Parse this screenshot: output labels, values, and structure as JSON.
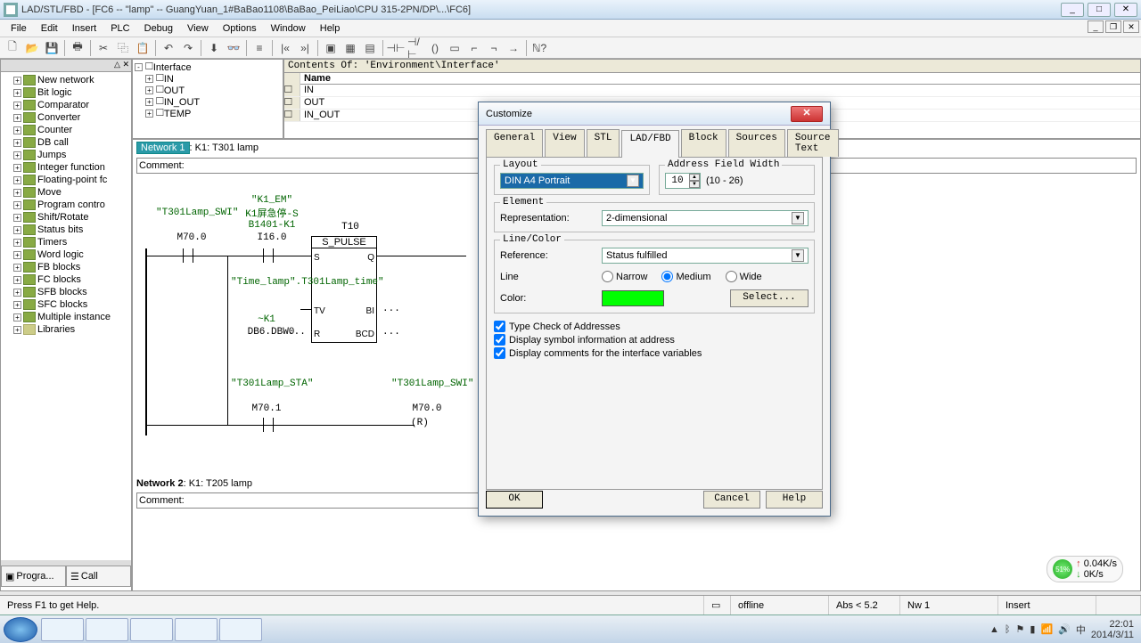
{
  "window": {
    "title": "LAD/STL/FBD  - [FC6 -- \"lamp\" -- GuangYuan_1#BaBao1108\\BaBao_PeiLiao\\CPU 315-2PN/DP\\...\\FC6]"
  },
  "menu": [
    "File",
    "Edit",
    "Insert",
    "PLC",
    "Debug",
    "View",
    "Options",
    "Window",
    "Help"
  ],
  "left_tree": [
    "New network",
    "Bit logic",
    "Comparator",
    "Converter",
    "Counter",
    "DB call",
    "Jumps",
    "Integer function",
    "Floating-point fc",
    "Move",
    "Program contro",
    "Shift/Rotate",
    "Status bits",
    "Timers",
    "Word logic",
    "FB blocks",
    "FC blocks",
    "SFB blocks",
    "SFC blocks",
    "Multiple instance",
    "Libraries"
  ],
  "bottom_tabs": {
    "left": "Progra...",
    "right": "Call"
  },
  "iface": {
    "header": "Contents Of: 'Environment\\Interface'",
    "root": "Interface",
    "nodes": [
      "IN",
      "OUT",
      "IN_OUT",
      "TEMP"
    ],
    "grid_header": "Name",
    "grid_rows": [
      "IN",
      "OUT",
      "IN_OUT"
    ]
  },
  "editor": {
    "net1": {
      "badge": "Network 1",
      "title": ": K1: T301 lamp",
      "comment": "Comment:"
    },
    "net2": {
      "badge_plain": "Network 2",
      "title": ": K1: T205 lamp",
      "comment": "Comment:"
    },
    "labels": {
      "swi": "\"T301Lamp_SWI\"",
      "swi_addr": "M70.0",
      "k1em": "\"K1_EM\"",
      "k1em_desc": "K1屏急停-S B1401-K1",
      "k1em_addr": "I16.0",
      "t10": "T10",
      "spulse": "S_PULSE",
      "s": "S",
      "q": "Q",
      "timelamp": "\"Time_lamp\".T301Lamp_time\"",
      "timelamp_k1": "~K1",
      "timelamp_addr": "DB6.DBW0",
      "tv": "TV",
      "bi": "BI",
      "r": "R",
      "bcd": "BCD",
      "dots": "...",
      "sta": "\"T301Lamp_STA\"",
      "sta_addr": "M70.1",
      "swi2": "\"T301Lamp_SWI\"",
      "swi2_addr": "M70.0",
      "coil_r": "(R)"
    }
  },
  "dialog": {
    "title": "Customize",
    "tabs": [
      "General",
      "View",
      "STL",
      "LAD/FBD",
      "Block",
      "Sources",
      "Source Text"
    ],
    "active_tab": 3,
    "layout": {
      "legend": "Layout",
      "value": "DIN A4 Portrait"
    },
    "addr": {
      "legend": "Address Field Width",
      "value": "10",
      "range": "(10 - 26)"
    },
    "element": {
      "legend": "Element",
      "rep_label": "Representation:",
      "rep_value": "2-dimensional"
    },
    "linecolor": {
      "legend": "Line/Color",
      "ref_label": "Reference:",
      "ref_value": "Status fulfilled",
      "line_label": "Line",
      "radios": [
        "Narrow",
        "Medium",
        "Wide"
      ],
      "color_label": "Color:",
      "select_btn": "Select...",
      "color_hex": "#00ff00"
    },
    "checks": [
      "Type Check of Addresses",
      "Display symbol information at address",
      "Display comments for the interface variables"
    ],
    "buttons": {
      "ok": "OK",
      "cancel": "Cancel",
      "help": "Help"
    }
  },
  "status": {
    "hint": "Press F1 to get Help.",
    "offline": "offline",
    "abs": "Abs < 5.2",
    "nw": "Nw 1",
    "insert": "Insert"
  },
  "speed": {
    "pct": "51%",
    "up": "0.04K/s",
    "down": "0K/s"
  },
  "tray": {
    "time": "22:01",
    "date": "2014/3/11"
  }
}
